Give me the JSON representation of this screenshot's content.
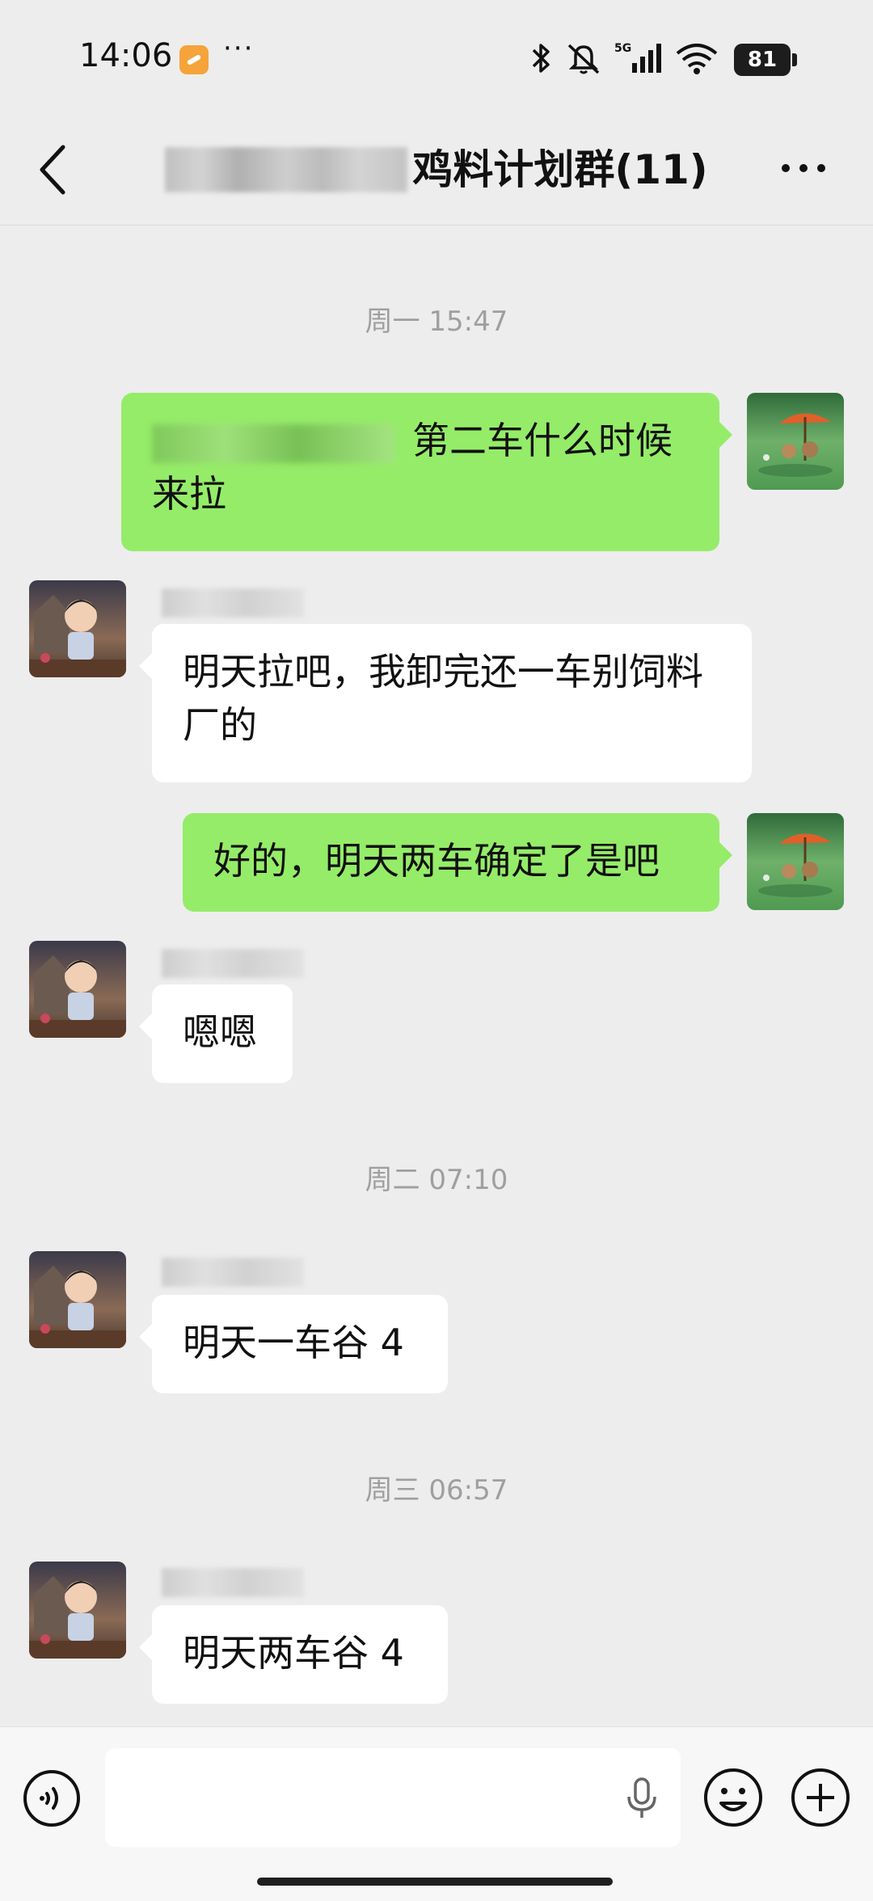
{
  "status_bar": {
    "time": "14:06",
    "notifications_more": "···",
    "battery": "81",
    "icons": [
      "bluetooth-icon",
      "mute-icon",
      "5g-signal-icon",
      "wifi-icon",
      "battery-icon"
    ]
  },
  "header": {
    "title": "鸡料计划群(11)",
    "back_icon": "chevron-left-icon",
    "menu_icon": "more-dots-icon"
  },
  "colors": {
    "background": "#ededed",
    "outgoing_bubble": "#95ec69",
    "incoming_bubble": "#ffffff",
    "timestamp_text": "#9f9f9f"
  },
  "messages": [
    {
      "type": "time",
      "text": "周一 15:47"
    },
    {
      "type": "out",
      "text": "第二车什么时候来拉"
    },
    {
      "type": "in",
      "text": "明天拉吧，我卸完还一车别饲料厂的"
    },
    {
      "type": "out",
      "text": "好的，明天两车确定了是吧"
    },
    {
      "type": "in",
      "text": "嗯嗯"
    },
    {
      "type": "time",
      "text": "周二 07:10"
    },
    {
      "type": "in",
      "text": "明天一车谷 4"
    },
    {
      "type": "time",
      "text": "周三 06:57"
    },
    {
      "type": "in",
      "text": "明天两车谷 4"
    }
  ],
  "input_bar": {
    "voice_icon": "voice-toggle-icon",
    "mic_icon": "microphone-icon",
    "emoji_icon": "emoji-icon",
    "plus_icon": "plus-icon"
  }
}
